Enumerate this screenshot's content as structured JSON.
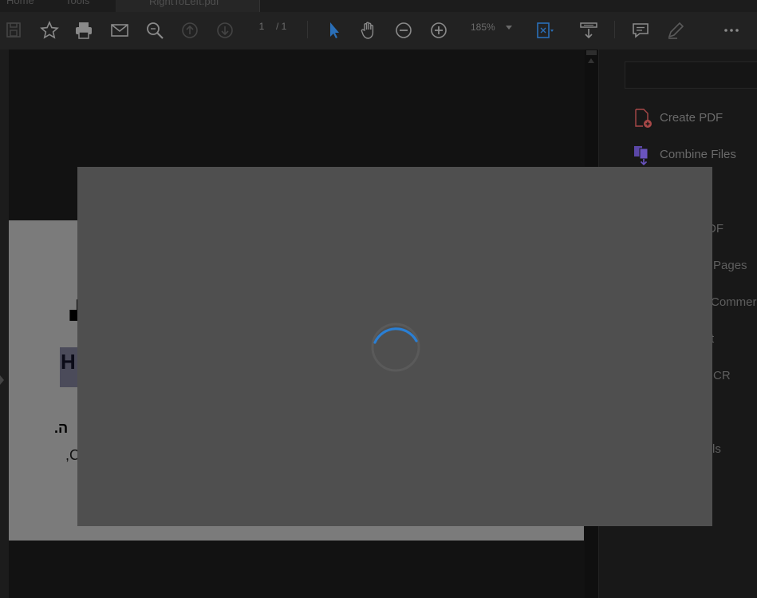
{
  "tabs": [
    {
      "label": "Home"
    },
    {
      "label": "Tools"
    },
    {
      "label": "RightToLeft.pdf"
    }
  ],
  "toolbar": {
    "page_current": "1",
    "page_total": "/ 1",
    "zoom": "185%"
  },
  "document_fragments": {
    "heading_fragment": "H",
    "line1_fragment": ".ה",
    "line2_fragment": ",C"
  },
  "right_panel": {
    "tools": [
      {
        "label": "Create PDF",
        "icon": "create-pdf-icon",
        "color": "#b24a4a"
      },
      {
        "label": "Combine Files",
        "icon": "combine-files-icon",
        "color": "#6a4fbf"
      }
    ],
    "partial_labels": [
      "DF",
      "Pages",
      "Commer",
      "t",
      "CR",
      "ls"
    ]
  },
  "overlay": {
    "state": "loading",
    "spinner_color": "#2a7fd4"
  },
  "colors": {
    "accent": "#2a7fd4",
    "modal_bg": "#4f4f4f"
  }
}
